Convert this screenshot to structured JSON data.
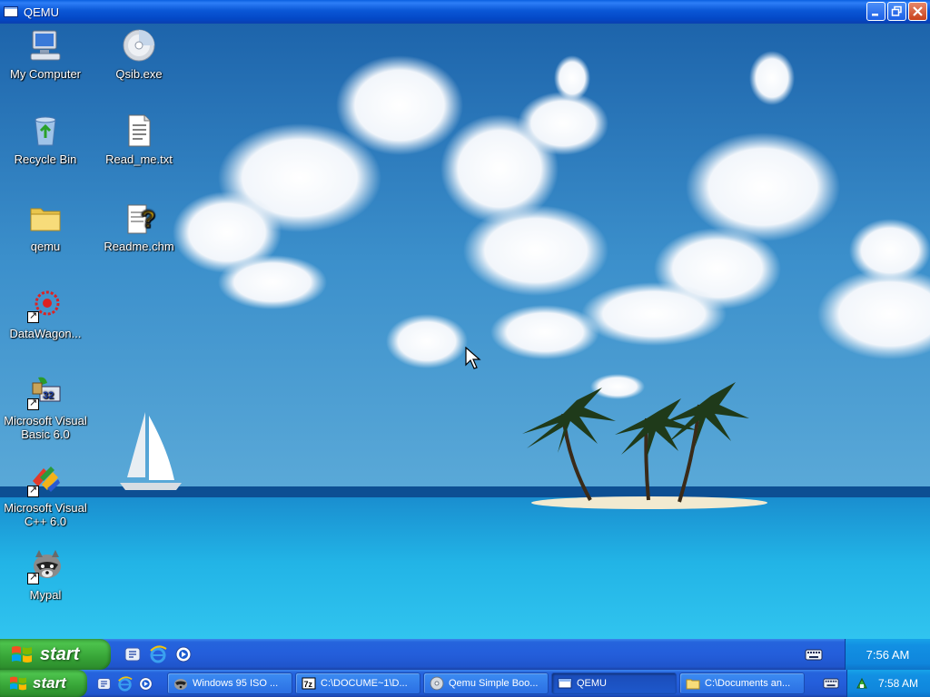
{
  "window": {
    "title": "QEMU",
    "controls": [
      "minimize-icon",
      "restore-icon",
      "close-icon"
    ]
  },
  "desktop": {
    "icons": [
      {
        "label": "My Computer",
        "icon": "computer-icon",
        "shortcut": false
      },
      {
        "label": "Qsib.exe",
        "icon": "cd-icon",
        "shortcut": false
      },
      {
        "label": "Recycle Bin",
        "icon": "recycle-bin-icon",
        "shortcut": false
      },
      {
        "label": "Read_me.txt",
        "icon": "text-file-icon",
        "shortcut": false
      },
      {
        "label": "qemu",
        "icon": "folder-icon",
        "shortcut": false
      },
      {
        "label": "Readme.chm",
        "icon": "help-file-icon",
        "shortcut": false
      },
      {
        "label": "DataWagon...",
        "icon": "datawagon-icon",
        "shortcut": true
      },
      {
        "label": "Microsoft Visual Basic 6.0",
        "icon": "visual-basic-icon",
        "shortcut": true
      },
      {
        "label": "Microsoft Visual C++ 6.0",
        "icon": "visual-cpp-icon",
        "shortcut": true
      },
      {
        "label": "Mypal",
        "icon": "raccoon-icon",
        "shortcut": true
      }
    ]
  },
  "guest_taskbar": {
    "start_label": "start",
    "quick_launch": [
      "windows-update-icon",
      "internet-explorer-icon",
      "media-player-icon"
    ],
    "tray_icon": "keyboard-icon",
    "clock": "7:56 AM"
  },
  "host_taskbar": {
    "start_label": "start",
    "quick_launch": [
      "windows-update-icon",
      "internet-explorer-icon",
      "media-player-icon"
    ],
    "tasks": [
      {
        "label": "Windows 95 ISO ...",
        "icon": "raccoon-icon",
        "active": false
      },
      {
        "label": "C:\\DOCUME~1\\D...",
        "icon": "7zip-icon",
        "active": false
      },
      {
        "label": "Qemu Simple Boo...",
        "icon": "cd-icon",
        "active": false
      },
      {
        "label": "QEMU",
        "icon": "window-icon",
        "active": true
      },
      {
        "label": "C:\\Documents an...",
        "icon": "folder-icon",
        "active": false
      }
    ],
    "tray_icons": [
      "keyboard-icon",
      "network-icon"
    ],
    "clock": "7:58 AM"
  },
  "colors": {
    "taskbar_blue": "#245edb",
    "start_green": "#3ea43e",
    "tray_blue": "#0f86dc",
    "titlebar_blue": "#0a57d6"
  }
}
